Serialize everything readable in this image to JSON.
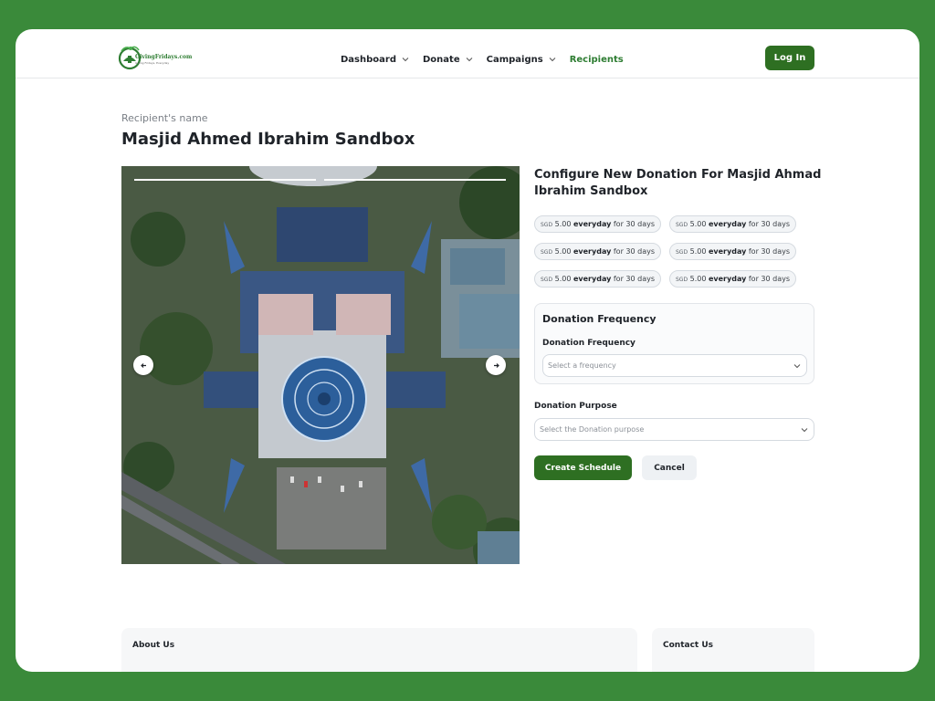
{
  "nav": {
    "logo_text": "GivingFridays.com",
    "logo_tagline": "Giving Fridays, Everyday",
    "items": [
      {
        "label": "Dashboard",
        "has_dropdown": true
      },
      {
        "label": "Donate",
        "has_dropdown": true
      },
      {
        "label": "Campaigns",
        "has_dropdown": true
      },
      {
        "label": "Recipients",
        "has_dropdown": false,
        "active": true
      }
    ],
    "login_label": "Log In"
  },
  "recipient": {
    "label": "Recipient's name",
    "name": "Masjid Ahmed Ibrahim Sandbox"
  },
  "carousel": {
    "slide_count": 2,
    "active_slide": 1,
    "image_desc_icon": "mosque-aerial-photo"
  },
  "config": {
    "title": "Configure New Donation For Masjid Ahmad Ibrahim Sandbox",
    "presets": [
      {
        "currency": "SGD",
        "amount": "5.00",
        "frequency": "everyday",
        "duration": "for 30 days"
      },
      {
        "currency": "SGD",
        "amount": "5.00",
        "frequency": "everyday",
        "duration": "for 30 days"
      },
      {
        "currency": "SGD",
        "amount": "5.00",
        "frequency": "everyday",
        "duration": "for 30 days"
      },
      {
        "currency": "SGD",
        "amount": "5.00",
        "frequency": "everyday",
        "duration": "for 30 days"
      },
      {
        "currency": "SGD",
        "amount": "5.00",
        "frequency": "everyday",
        "duration": "for 30 days"
      },
      {
        "currency": "SGD",
        "amount": "5.00",
        "frequency": "everyday",
        "duration": "for 30 days"
      }
    ],
    "frequency_box_title": "Donation Frequency",
    "frequency_label": "Donation Frequency",
    "frequency_placeholder": "Select a frequency",
    "purpose_label": "Donation Purpose",
    "purpose_placeholder": "Select the Donation purpose",
    "create_label": "Create Schedule",
    "cancel_label": "Cancel"
  },
  "footer": {
    "about_title": "About Us",
    "contact_title": "Contact Us"
  },
  "colors": {
    "brand_green": "#2e6f22",
    "frame_green": "#3a8a3a",
    "active_nav": "#2e7d32"
  }
}
